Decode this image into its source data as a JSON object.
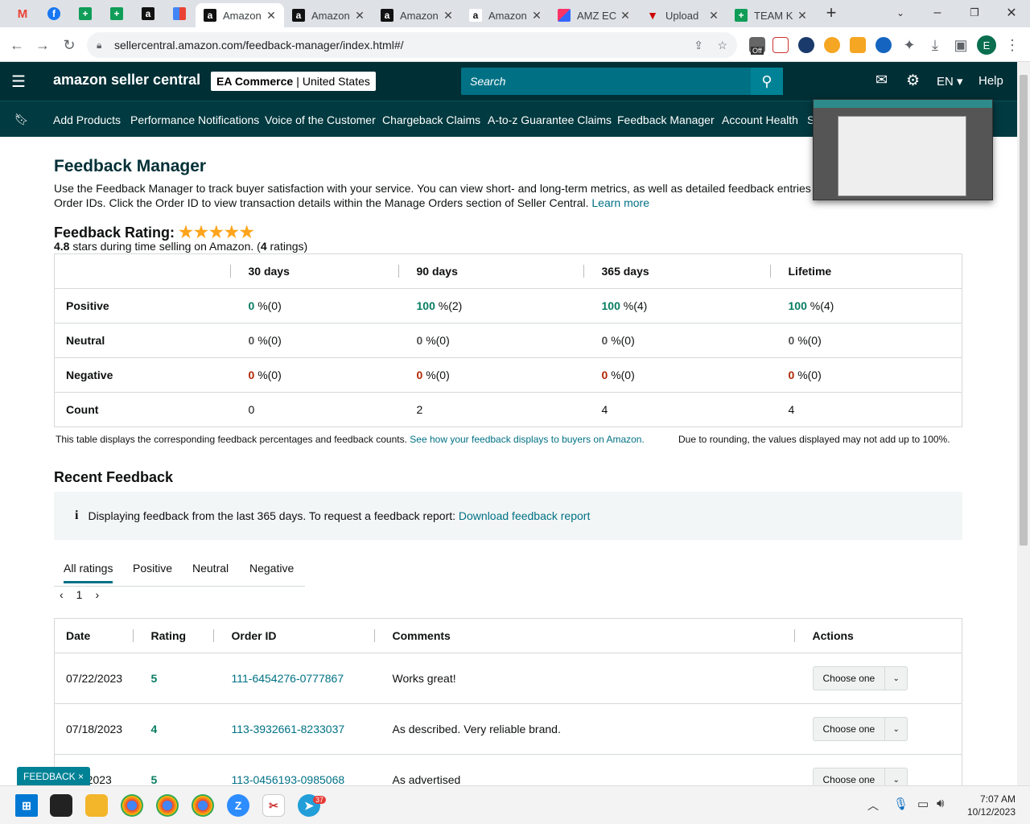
{
  "browser": {
    "tabs": [
      {
        "title": "Amazon",
        "active": true
      },
      {
        "title": "Amazon",
        "active": false
      },
      {
        "title": "Amazon",
        "active": false
      },
      {
        "title": "Amazon",
        "active": false
      },
      {
        "title": "AMZ EC",
        "active": false
      },
      {
        "title": "Upload",
        "active": false
      },
      {
        "title": "TEAM K",
        "active": false
      }
    ],
    "url": "sellercentral.amazon.com/feedback-manager/index.html#/",
    "ext_badge": "Off",
    "profile_letter": "E"
  },
  "header": {
    "logo": "amazon seller central",
    "store_name": "EA Commerce",
    "store_region": "United States",
    "search_placeholder": "Search",
    "lang": "EN",
    "help": "Help"
  },
  "nav": {
    "items": [
      "Add Products",
      "Performance Notifications",
      "Voice of the Customer",
      "Chargeback Claims",
      "A-to-z Guarantee Claims",
      "Feedback Manager",
      "Account Health",
      "S"
    ]
  },
  "page": {
    "title": "Feedback Manager",
    "intro": "Use the Feedback Manager to track buyer satisfaction with your service. You can view short- and long-term metrics, as well as detailed feedback entries including buyer e-mails and Order IDs. Click the Order ID to view transaction details within the Manage Orders section of Seller Central.",
    "learn_more": "Learn more",
    "rating_label": "Feedback Rating:",
    "rating_value": "4.8",
    "rating_text": "stars during time selling on Amazon. (",
    "rating_count": "4",
    "rating_suffix": "ratings)",
    "stars": "★★★★★"
  },
  "summary": {
    "columns": [
      "30 days",
      "90 days",
      "365 days",
      "Lifetime"
    ],
    "rows": [
      {
        "label": "Positive",
        "cells": [
          {
            "v": "0",
            "s": "%(0)"
          },
          {
            "v": "100",
            "s": "%(2)"
          },
          {
            "v": "100",
            "s": "%(4)"
          },
          {
            "v": "100",
            "s": "%(4)"
          }
        ]
      },
      {
        "label": "Neutral",
        "cells": [
          {
            "v": "0",
            "s": "%(0)"
          },
          {
            "v": "0",
            "s": "%(0)"
          },
          {
            "v": "0",
            "s": "%(0)"
          },
          {
            "v": "0",
            "s": "%(0)"
          }
        ]
      },
      {
        "label": "Negative",
        "cells": [
          {
            "v": "0",
            "s": "%(0)"
          },
          {
            "v": "0",
            "s": "%(0)"
          },
          {
            "v": "0",
            "s": "%(0)"
          },
          {
            "v": "0",
            "s": "%(0)"
          }
        ]
      }
    ],
    "count_label": "Count",
    "counts": [
      "0",
      "2",
      "4",
      "4"
    ],
    "note_left": "This table displays the corresponding feedback percentages and feedback counts.",
    "note_link": "See how your feedback displays to buyers on Amazon.",
    "note_right": "Due to rounding, the values displayed may not add up to 100%."
  },
  "recent": {
    "title": "Recent Feedback",
    "info_text": "Displaying feedback from the last 365 days. To request a feedback report:",
    "info_link": "Download feedback report",
    "tabs": [
      "All ratings",
      "Positive",
      "Neutral",
      "Negative"
    ],
    "page": "1",
    "columns": [
      "Date",
      "Rating",
      "Order ID",
      "Comments",
      "Actions"
    ],
    "rows": [
      {
        "date": "07/22/2023",
        "rating": "5",
        "order": "111-6454276-0777867",
        "comment": "Works great!",
        "action": "Choose one"
      },
      {
        "date": "07/18/2023",
        "rating": "4",
        "order": "113-3932661-8233037",
        "comment": "As described. Very reliable brand.",
        "action": "Choose one"
      },
      {
        "date": "…9/2023",
        "rating": "5",
        "order": "113-0456193-0985068",
        "comment": "As advertised",
        "action": "Choose one"
      }
    ]
  },
  "feedback_tab": "FEEDBACK ×",
  "taskbar": {
    "time": "7:07 AM",
    "date": "10/12/2023",
    "telegram_badge": "37"
  }
}
